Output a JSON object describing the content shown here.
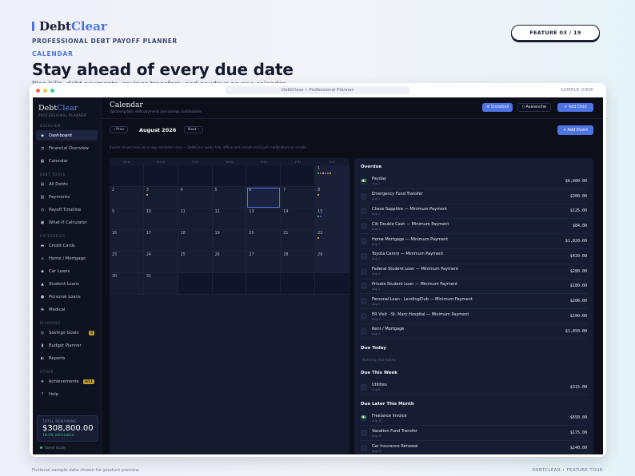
{
  "brand": {
    "name_a": "Debt",
    "name_b": "Clear",
    "tagline": "PROFESSIONAL DEBT PAYOFF PLANNER"
  },
  "hero": {
    "section": "CALENDAR",
    "title": "Stay ahead of every due date",
    "lead": "Plan bills, debt payments, savings transfers, and paydays on one calendar."
  },
  "feature_badge": "FEATURE 03 / 19",
  "window": {
    "title": "DebtClear  •  Professional Planner",
    "view_label": "SAMPLE VIEW",
    "colors": [
      "#f25f5c",
      "#f5c242",
      "#3ecf8e"
    ]
  },
  "sidebar": {
    "logo_a": "Debt",
    "logo_b": "Clear",
    "logo_tag": "PROFESSIONAL PLANNER",
    "sections": [
      {
        "heading": "OVERVIEW",
        "items": [
          {
            "label": "Dashboard",
            "icon": "◈",
            "active": true
          },
          {
            "label": "Financial Overview",
            "icon": "◔"
          },
          {
            "label": "Calendar",
            "icon": "▦"
          }
        ]
      },
      {
        "heading": "DEBT TOOLS",
        "items": [
          {
            "label": "All Debts",
            "icon": "▤"
          },
          {
            "label": "Payments",
            "icon": "▥"
          },
          {
            "label": "Payoff Timeline",
            "icon": "◷"
          },
          {
            "label": "What-If Calculator",
            "icon": "▣"
          }
        ]
      },
      {
        "heading": "CATEGORIES",
        "items": [
          {
            "label": "Credit Cards",
            "icon": "▬"
          },
          {
            "label": "Home / Mortgage",
            "icon": "⌂"
          },
          {
            "label": "Car Loans",
            "icon": "◆"
          },
          {
            "label": "Student Loans",
            "icon": "▲"
          },
          {
            "label": "Personal Loans",
            "icon": "●"
          },
          {
            "label": "Medical",
            "icon": "✚"
          }
        ]
      },
      {
        "heading": "PLANNING",
        "items": [
          {
            "label": "Savings Goals",
            "icon": "◎",
            "badge": "3"
          },
          {
            "label": "Budget Planner",
            "icon": "▮"
          },
          {
            "label": "Reports",
            "icon": "◐"
          }
        ]
      },
      {
        "heading": "OTHER",
        "items": [
          {
            "label": "Achievements",
            "icon": "★",
            "badge": "6/11"
          },
          {
            "label": "Help",
            "icon": "?"
          }
        ]
      }
    ],
    "total_label": "TOTAL REMAINING",
    "total_value": "$308,800.00",
    "total_pct": "18.4% eliminated",
    "saved": "Saved locally"
  },
  "main": {
    "title": "Calendar",
    "subtitle": "Upcoming bills, debt payments and savings contributions",
    "buttons": {
      "snowball": "❄ Snowball",
      "avalanche": "▯ Avalanche",
      "add_debt": "+ Add Debt"
    },
    "prev": "‹ Prev",
    "next": "Next ›",
    "month": "August 2026",
    "add_event": "+ Add Event",
    "note": "Events shown here are in-app reminders only — DebtClear works fully offline and cannot send push notifications or emails.",
    "weekdays": [
      "SUN",
      "MON",
      "TUE",
      "WED",
      "THU",
      "FRI",
      "SAT"
    ],
    "weeks": [
      [
        "",
        "",
        "",
        "",
        "",
        "",
        "1"
      ],
      [
        "2",
        "3",
        "4",
        "5",
        "6",
        "7",
        "8"
      ],
      [
        "9",
        "10",
        "11",
        "12",
        "13",
        "14",
        "15"
      ],
      [
        "16",
        "17",
        "18",
        "19",
        "20",
        "21",
        "22"
      ],
      [
        "23",
        "24",
        "25",
        "26",
        "27",
        "28",
        "29"
      ],
      [
        "30",
        "31",
        "",
        "",
        "",
        "",
        ""
      ]
    ],
    "today": "6"
  },
  "events": {
    "overdue_heading": "Overdue",
    "overdue": [
      {
        "name": "Payday",
        "date": "Aug 1",
        "amount": "$6,800.00",
        "icon": "💵"
      },
      {
        "name": "Emergency Fund Transfer",
        "date": "Aug 1",
        "amount": "$300.00",
        "icon": "◎"
      },
      {
        "name": "Chase Sapphire — Minimum Payment",
        "date": "Aug 1",
        "amount": "$125.00",
        "icon": "▬"
      },
      {
        "name": "Citi Double Cash — Minimum Payment",
        "date": "Aug 1",
        "amount": "$84.00",
        "icon": "▬"
      },
      {
        "name": "Home Mortgage — Minimum Payment",
        "date": "Aug 1",
        "amount": "$1,820.00",
        "icon": "▬"
      },
      {
        "name": "Toyota Camry — Minimum Payment",
        "date": "Aug 1",
        "amount": "$420.00",
        "icon": "▬"
      },
      {
        "name": "Federal Student Loan — Minimum Payment",
        "date": "Aug 1",
        "amount": "$280.00",
        "icon": "▬"
      },
      {
        "name": "Private Student Loan — Minimum Payment",
        "date": "Aug 1",
        "amount": "$180.00",
        "icon": "▬"
      },
      {
        "name": "Personal Loan - LendingClub — Minimum Payment",
        "date": "Aug 1",
        "amount": "$206.00",
        "icon": "▬"
      },
      {
        "name": "ER Visit - St. Mary Hospital — Minimum Payment",
        "date": "Aug 1",
        "amount": "$100.00",
        "icon": "▬"
      },
      {
        "name": "Rent / Mortgage",
        "date": "Aug 1",
        "amount": "$1,850.00",
        "icon": "▤"
      }
    ],
    "today_heading": "Due Today",
    "today_empty": "Nothing due today.",
    "week_heading": "Due This Week",
    "week": [
      {
        "name": "Utilities",
        "date": "Aug 6",
        "amount": "$315.00",
        "icon": "▤"
      }
    ],
    "later_heading": "Due Later This Month",
    "later": [
      {
        "name": "Freelance Invoice",
        "date": "Aug 10",
        "amount": "$650.00",
        "icon": "💵"
      },
      {
        "name": "Vacation Fund Transfer",
        "date": "Aug 15",
        "amount": "$175.00",
        "icon": "◎"
      },
      {
        "name": "Car Insurance Renewal",
        "date": "Aug 22",
        "amount": "$240.00",
        "icon": "▤"
      }
    ]
  },
  "footer": {
    "left": "Fictional sample data shown for product preview",
    "right": "DEBTCLEAR  •  FEATURE TOUR"
  }
}
